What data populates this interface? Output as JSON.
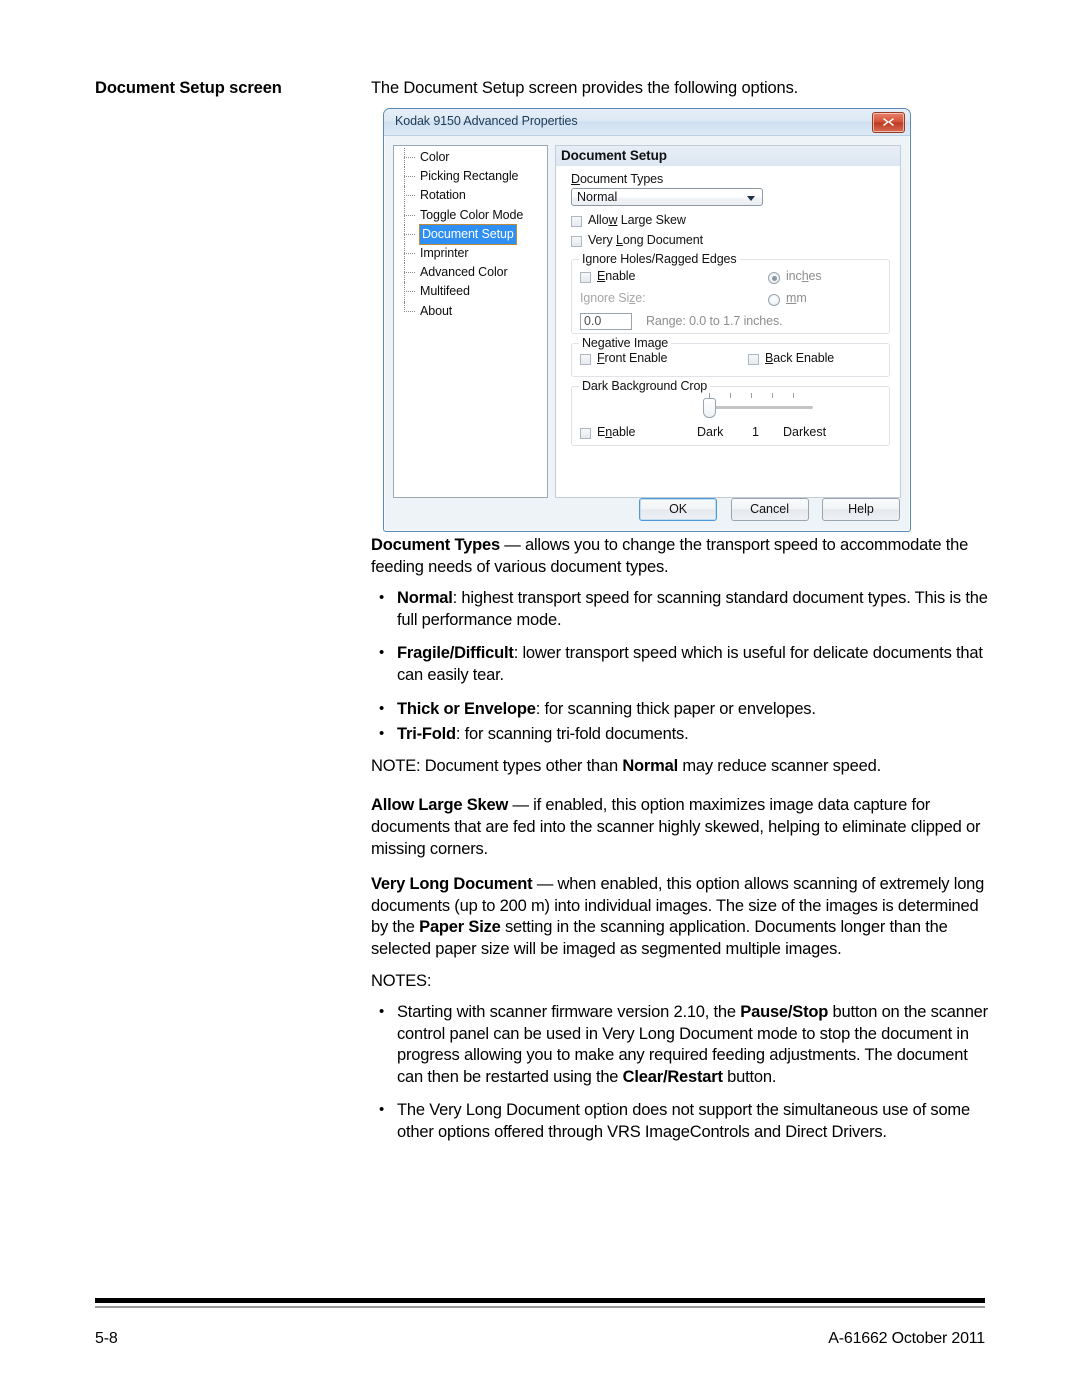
{
  "page": {
    "side_heading": "Document Setup screen",
    "intro": "The Document Setup screen provides the following options."
  },
  "dialog": {
    "title": "Kodak 9150 Advanced Properties",
    "close_label": "✕",
    "tree": {
      "items": [
        {
          "label": "Color",
          "selected": false
        },
        {
          "label": "Picking Rectangle",
          "selected": false
        },
        {
          "label": "Rotation",
          "selected": false
        },
        {
          "label": "Toggle Color Mode",
          "selected": false
        },
        {
          "label": "Document Setup",
          "selected": true
        },
        {
          "label": "Imprinter",
          "selected": false
        },
        {
          "label": "Advanced Color",
          "selected": false
        },
        {
          "label": "Multifeed",
          "selected": false
        },
        {
          "label": "About",
          "selected": false
        }
      ]
    },
    "panel": {
      "title": "Document Setup",
      "document_types_label": "Document Types",
      "document_types_value": "Normal",
      "allow_large_skew_label": "Allow Large Skew",
      "very_long_document_label": "Very Long Document",
      "ignore_holes": {
        "legend": "Ignore Holes/Ragged Edges",
        "enable_label": "Enable",
        "inches_label": "inches",
        "mm_label": "mm",
        "ignore_size_label": "Ignore Size:",
        "size_value": "0.0",
        "range_text": "Range: 0.0 to 1.7 inches."
      },
      "negative_image": {
        "legend": "Negative Image",
        "front_label": "Front Enable",
        "back_label": "Back Enable"
      },
      "dark_background_crop": {
        "legend": "Dark Background Crop",
        "enable_label": "Enable",
        "min_label": "Dark",
        "value_label": "1",
        "max_label": "Darkest"
      }
    },
    "buttons": {
      "ok": "OK",
      "cancel": "Cancel",
      "help": "Help"
    },
    "colors": {
      "selection": "#2f8ff5",
      "titlebar": "#cfe0f0",
      "close": "#bc3a24",
      "border": "#5a8ab5"
    }
  },
  "body": {
    "p_document_types_bold": "Document Types",
    "p_document_types_rest": " — allows you to change the transport speed to accommodate the feeding needs of various document types.",
    "bullets_types": [
      {
        "bold": "Normal",
        "rest": ": highest transport speed for scanning standard document types. This is the full performance mode."
      },
      {
        "bold": "Fragile/Difficult",
        "rest": ": lower transport speed which is useful for delicate documents that can easily tear."
      },
      {
        "bold": "Thick or Envelope",
        "rest": ": for scanning thick paper or envelopes."
      },
      {
        "bold": "Tri-Fold",
        "rest": ": for scanning tri-fold documents."
      }
    ],
    "note_types_pre": "NOTE: Document types other than ",
    "note_types_bold": "Normal",
    "note_types_post": " may reduce scanner speed.",
    "p_allow_skew_bold": "Allow Large Skew",
    "p_allow_skew_rest": " — if enabled, this option maximizes image data capture for documents that are fed into the scanner highly skewed, helping to eliminate clipped or missing corners.",
    "p_vld_bold": "Very Long Document",
    "p_vld_part1": " — when enabled, this option allows scanning of extremely long documents (up to 200 m) into individual images. The size of the images is determined by the ",
    "p_vld_bold2": "Paper Size",
    "p_vld_part2": " setting in the scanning application. Documents longer than the selected paper size will be imaged as segmented multiple images.",
    "notes_heading": "NOTES:",
    "note1_part1": "Starting with scanner firmware version 2.10, the ",
    "note1_bold1": "Pause/Stop",
    "note1_part2": " button on the scanner control panel can be used in Very Long Document mode to stop the document in progress allowing you to make any required feeding adjustments. The document can then be restarted using the ",
    "note1_bold2": "Clear/Restart",
    "note1_part3": " button.",
    "note2": "The Very Long Document option does not support the simultaneous use of some other options offered through VRS ImageControls and Direct Drivers."
  },
  "footer": {
    "page_number": "5-8",
    "doc_id": "A-61662 October 2011"
  }
}
